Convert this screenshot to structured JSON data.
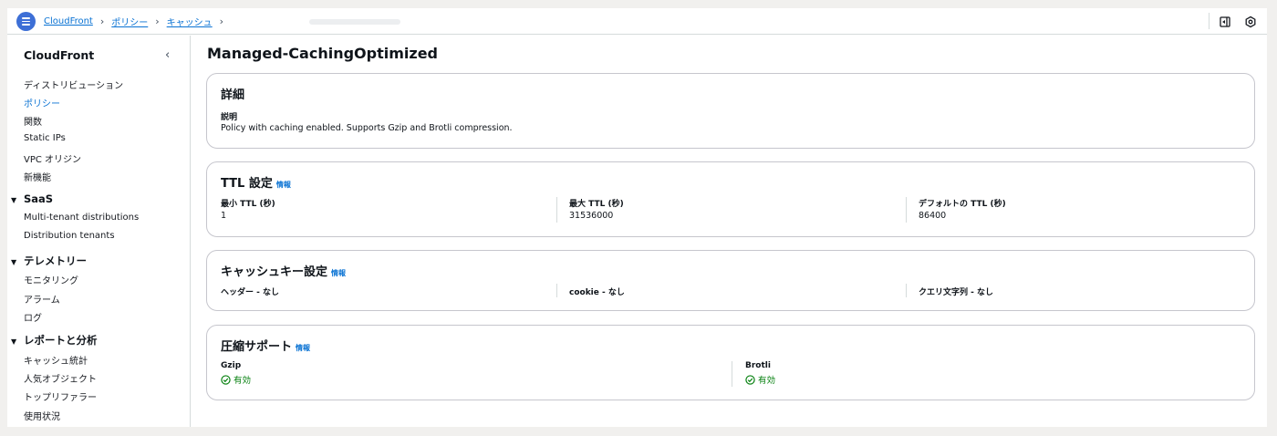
{
  "breadcrumb": {
    "items": [
      "CloudFront",
      "ポリシー",
      "キャッシュ"
    ]
  },
  "sidebar": {
    "title": "CloudFront",
    "items": [
      "ディストリビューション",
      "ポリシー",
      "関数",
      "Static IPs",
      "VPC オリジン",
      "新機能"
    ],
    "active_item": "ポリシー",
    "groups": [
      {
        "label": "SaaS",
        "items": [
          "Multi-tenant distributions",
          "Distribution tenants"
        ]
      },
      {
        "label": "テレメトリー",
        "items": [
          "モニタリング",
          "アラーム",
          "ログ"
        ]
      },
      {
        "label": "レポートと分析",
        "items": [
          "キャッシュ統計",
          "人気オブジェクト",
          "トップリファラー",
          "使用状況"
        ]
      }
    ]
  },
  "page": {
    "title": "Managed-CachingOptimized"
  },
  "details": {
    "title": "詳細",
    "description_label": "説明",
    "description": "Policy with caching enabled. Supports Gzip and Brotli compression."
  },
  "ttl": {
    "title": "TTL 設定",
    "info": "情報",
    "min_label": "最小 TTL (秒)",
    "min_value": "1",
    "max_label": "最大 TTL (秒)",
    "max_value": "31536000",
    "default_label": "デフォルトの TTL (秒)",
    "default_value": "86400"
  },
  "cache_key": {
    "title": "キャッシュキー設定",
    "info": "情報",
    "headers": "ヘッダー - なし",
    "cookies": "cookie - なし",
    "query": "クエリ文字列 - なし"
  },
  "compression": {
    "title": "圧縮サポート",
    "info": "情報",
    "gzip_label": "Gzip",
    "gzip_value": "有効",
    "brotli_label": "Brotli",
    "brotli_value": "有効",
    "status_color": "#037f0c"
  },
  "colors": {
    "accent": "#0972d3",
    "menu_button": "#3d6fd6"
  }
}
